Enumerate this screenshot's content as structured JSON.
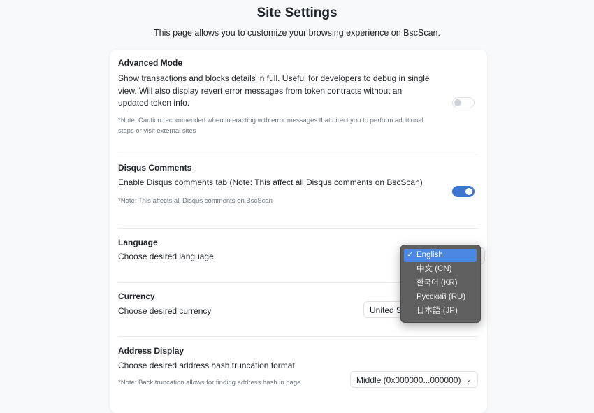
{
  "page": {
    "title": "Site Settings",
    "subtitle": "This page allows you to customize your browsing experience on BscScan."
  },
  "advanced_mode": {
    "title": "Advanced Mode",
    "description": "Show transactions and blocks details in full. Useful for developers to debug in single view. Will also display revert error messages from token contracts without an updated token info.",
    "note": "*Note: Caution recommended when interacting with error messages that direct you to perform additional steps or visit external sites",
    "enabled": false
  },
  "disqus": {
    "title": "Disqus Comments",
    "description": "Enable Disqus comments tab (Note: This affect all Disqus comments on BscScan)",
    "note": "*Note: This affects all Disqus comments on BscScan",
    "enabled": true
  },
  "language": {
    "title": "Language",
    "description": "Choose desired language",
    "selected": "English",
    "options": [
      "English",
      "中文 (CN)",
      "한국어 (KR)",
      "Русский (RU)",
      "日本語 (JP)"
    ]
  },
  "currency": {
    "title": "Currency",
    "description": "Choose desired currency",
    "selected": "United St"
  },
  "address_display": {
    "title": "Address Display",
    "description": "Choose desired address hash truncation format",
    "note": "*Note: Back truncation allows for finding address hash in page",
    "selected": "Middle (0x000000...000000)"
  },
  "icons": {
    "check": "checkmark-icon",
    "chevron": "chevron-down-icon"
  },
  "colors": {
    "accent": "#3d75d1",
    "dropdown_bg": "#5f5f60",
    "dropdown_selected": "#4a88e3"
  }
}
